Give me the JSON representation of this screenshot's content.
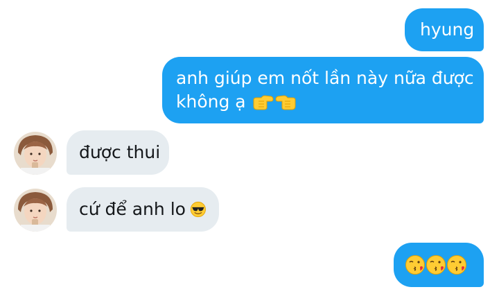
{
  "conversation": {
    "accent_color": "#1da1f2",
    "received_color": "#e6ecf0",
    "messages": [
      {
        "sender": "me",
        "text": "hyung"
      },
      {
        "sender": "me",
        "line1": "anh giúp em nốt lần này nữa được",
        "line2": "không ạ",
        "emojis": [
          "pointing-right-emoji",
          "pointing-left-emoji"
        ]
      },
      {
        "sender": "other",
        "text": "được thui"
      },
      {
        "sender": "other",
        "text": "cứ để anh lo",
        "emojis": [
          "sunglasses-face-emoji"
        ]
      },
      {
        "sender": "me",
        "emojis": [
          "kissing-face-emoji",
          "kissing-face-emoji",
          "kissing-face-emoji"
        ]
      }
    ]
  }
}
